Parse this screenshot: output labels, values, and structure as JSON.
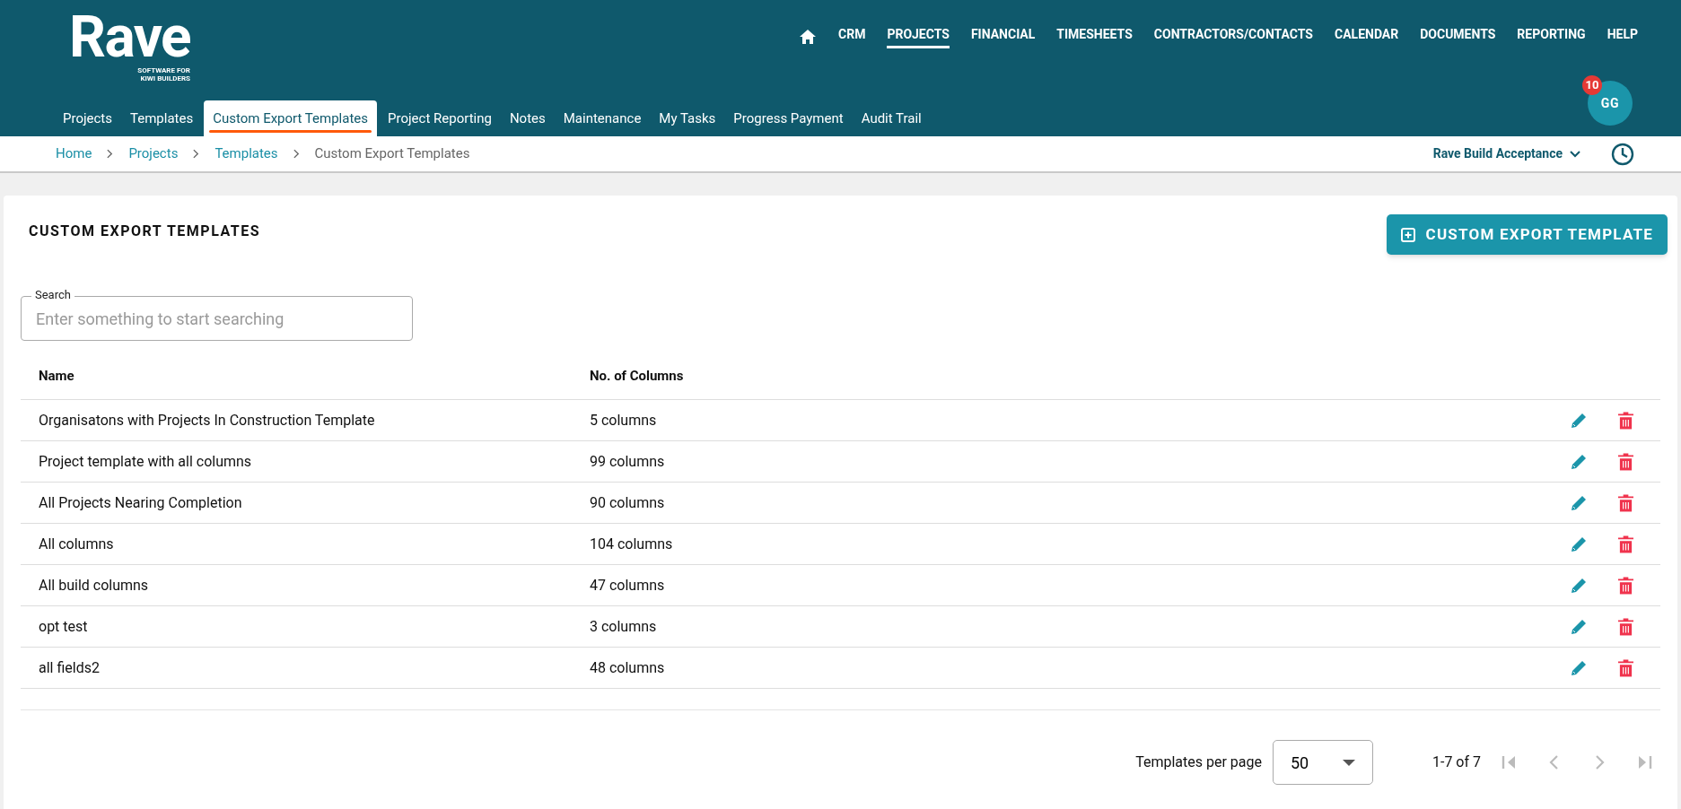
{
  "logo": {
    "wordmark": "Rave",
    "tagline_1": "SOFTWARE FOR",
    "tagline_2": "KIWI BUILDERS"
  },
  "main_nav": [
    {
      "label": "CRM",
      "selected": false
    },
    {
      "label": "PROJECTS",
      "selected": true
    },
    {
      "label": "FINANCIAL",
      "selected": false
    },
    {
      "label": "TIMESHEETS",
      "selected": false
    },
    {
      "label": "CONTRACTORS/CONTACTS",
      "selected": false
    },
    {
      "label": "CALENDAR",
      "selected": false
    },
    {
      "label": "DOCUMENTS",
      "selected": false
    },
    {
      "label": "REPORTING",
      "selected": false
    },
    {
      "label": "HELP",
      "selected": false
    }
  ],
  "sub_nav": [
    {
      "label": "Projects",
      "selected": false
    },
    {
      "label": "Templates",
      "selected": false
    },
    {
      "label": "Custom Export Templates",
      "selected": true
    },
    {
      "label": "Project Reporting",
      "selected": false
    },
    {
      "label": "Notes",
      "selected": false
    },
    {
      "label": "Maintenance",
      "selected": false
    },
    {
      "label": "My Tasks",
      "selected": false
    },
    {
      "label": "Progress Payment",
      "selected": false
    },
    {
      "label": "Audit Trail",
      "selected": false
    }
  ],
  "user": {
    "initials": "GG",
    "notification_count": "10"
  },
  "breadcrumb": [
    "Home",
    "Projects",
    "Templates",
    "Custom Export Templates"
  ],
  "company_selector": "Rave Build Acceptance",
  "page_title": "CUSTOM EXPORT TEMPLATES",
  "add_button": "CUSTOM EXPORT TEMPLATE",
  "search": {
    "label": "Search",
    "placeholder": "Enter something to start searching"
  },
  "table": {
    "columns": [
      "Name",
      "No. of Columns"
    ],
    "rows": [
      [
        "Organisatons with Projects In Construction Template",
        "5 columns"
      ],
      [
        "Project template with all columns",
        "99 columns"
      ],
      [
        "All Projects Nearing Completion",
        "90 columns"
      ],
      [
        "All columns",
        "104 columns"
      ],
      [
        "All build columns",
        "47 columns"
      ],
      [
        "opt test",
        "3 columns"
      ],
      [
        "all fields2",
        "48 columns"
      ]
    ]
  },
  "pagination": {
    "per_page_label": "Templates per page",
    "per_page": "50",
    "range": "1-7 of 7",
    "buttons": [
      {
        "kind": "first",
        "disabled": true
      },
      {
        "kind": "prev",
        "disabled": true
      },
      {
        "kind": "next",
        "disabled": true
      },
      {
        "kind": "last",
        "disabled": true
      }
    ]
  }
}
